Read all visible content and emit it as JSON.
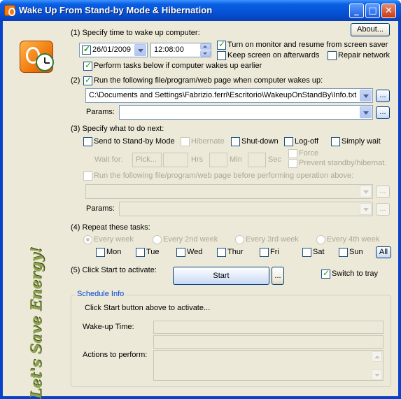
{
  "window": {
    "title": "Wake Up From Stand-by Mode & Hibernation",
    "minimize": "_",
    "maximize": "□",
    "close": "✕"
  },
  "slogan": "Let's Save Energy!",
  "about_button": "About...",
  "section1": {
    "label": "(1) Specify time to wake up computer:",
    "date": "26/01/2009",
    "date_checked": true,
    "time": "12:08:00",
    "turn_on_monitor": {
      "label": "Turn on monitor and resume from screen saver",
      "checked": true
    },
    "keep_screen": {
      "label": "Keep screen on afterwards",
      "checked": false
    },
    "repair_network": {
      "label": "Repair network",
      "checked": false
    },
    "perform_earlier": {
      "label": "Perform tasks below if computer wakes up earlier",
      "checked": true
    }
  },
  "section2": {
    "label": "Run the following file/program/web page when computer wakes up:",
    "prefix": "(2)",
    "checked": true,
    "path": "C:\\Documents and Settings\\Fabrizio.ferri\\Escritorio\\WakeupOnStandBy\\Info.txt",
    "params_label": "Params:",
    "params_value": "",
    "browse_label": "...",
    "params_browse_label": "..."
  },
  "section3": {
    "label": "(3) Specify what to do next:",
    "send_standby": {
      "label": "Send to Stand-by Mode",
      "checked": false
    },
    "hibernate": {
      "label": "Hibernate",
      "checked": false
    },
    "shutdown": {
      "label": "Shut-down",
      "checked": false
    },
    "logoff": {
      "label": "Log-off",
      "checked": false
    },
    "simply_wait": {
      "label": "Simply wait",
      "checked": false
    },
    "wait_for_label": "Wait for:",
    "pick_placeholder": "Pick...",
    "hrs": "Hrs",
    "min": "Min",
    "sec": "Sec",
    "force": "Force",
    "prevent": "Prevent standby/hibernat.",
    "run_before": "Run the following file/program/web page before performing operation above:",
    "params_label": "Params:",
    "browse_label": "...",
    "params_browse_label": "..."
  },
  "section4": {
    "label": "(4) Repeat these tasks:",
    "frequencies": [
      "Every week",
      "Every 2nd week",
      "Every 3rd week",
      "Every 4th week"
    ],
    "days": [
      "Mon",
      "Tue",
      "Wed",
      "Thur",
      "Fri",
      "Sat",
      "Sun"
    ],
    "all_label": "All"
  },
  "section5": {
    "label": "(5) Click Start to activate:",
    "start": "Start",
    "more": "...",
    "switch_tray": {
      "label": "Switch to tray",
      "checked": true
    }
  },
  "schedule": {
    "title": "Schedule Info",
    "hint": "Click Start button above to activate...",
    "wake_label": "Wake-up Time:",
    "actions_label": "Actions to perform:"
  }
}
